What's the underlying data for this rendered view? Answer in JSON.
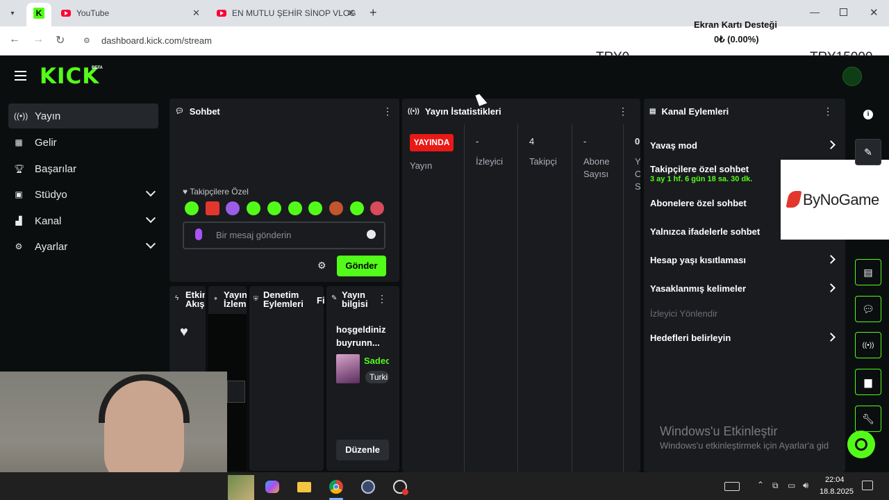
{
  "browser": {
    "tabs": [
      {
        "label": "YouTube"
      },
      {
        "label": "EN MUTLU ŞEHİR SİNOP VLOG"
      }
    ],
    "url": "dashboard.kick.com/stream"
  },
  "overlay": {
    "title": "Ekran Kartı Desteği",
    "amount": "0₺ (0.00%)",
    "min_label": "TRY0",
    "max_label": "TRY15000",
    "progress": 0,
    "sponsor": "ByNoGame"
  },
  "header": {
    "logo": "KICK",
    "beta": "BETA"
  },
  "sidebar": {
    "items": [
      {
        "label": "Yayın",
        "icon": "broadcast-icon",
        "active": true
      },
      {
        "label": "Gelir",
        "icon": "revenue-icon"
      },
      {
        "label": "Başarılar",
        "icon": "trophy-icon"
      },
      {
        "label": "Stüdyo",
        "icon": "studio-icon"
      },
      {
        "label": "Kanal",
        "icon": "channel-icon"
      },
      {
        "label": "Ayarlar",
        "icon": "gear-icon"
      }
    ]
  },
  "chat": {
    "title": "Sohbet",
    "followers_only": "Takipçilere Özel",
    "placeholder": "Bir mesaj gönderin",
    "send_label": "Gönder"
  },
  "lower_tabs": [
    {
      "label": "Etkin Akışı"
    },
    {
      "label": "Yayın İzlem"
    },
    {
      "label": "Denetim Eylemleri"
    },
    {
      "label": "Fi"
    },
    {
      "label": "Yayın bilgisi"
    }
  ],
  "stream_info": {
    "title": "hoşgeldiniz buyrunn...",
    "category": "Sadec",
    "tag": "Turki",
    "edit_label": "Düzenle"
  },
  "stats": {
    "title": "Yayın İstatistikleri",
    "live_badge": "YAYINDA",
    "columns": [
      {
        "value": "",
        "label": "Yayın"
      },
      {
        "value": "-",
        "label": "İzleyici"
      },
      {
        "value": "4",
        "label": "Takipçi"
      },
      {
        "value": "-",
        "label": "Abone Sayısı"
      },
      {
        "value": "0",
        "label": "Y O S"
      }
    ]
  },
  "channel_actions": {
    "title": "Kanal Eylemleri",
    "items": [
      {
        "label": "Yavaş mod"
      },
      {
        "label": "Takipçilere özel sohbet",
        "sub": "3 ay 1 hf. 6 gün 18 sa. 30 dk."
      },
      {
        "label": "Abonelere özel sohbet"
      },
      {
        "label": "Yalnızca ifadelerle sohbet"
      },
      {
        "label": "Hesap yaşı kısıtlaması"
      },
      {
        "label": "Yasaklanmış kelimeler"
      },
      {
        "label": "İzleyici Yönlendir"
      },
      {
        "label": "Hedefleri belirleyin"
      }
    ]
  },
  "watermark": {
    "line1": "Windows'u Etkinleştir",
    "line2": "Windows'u etkinleştirmek için Ayarlar'a gid"
  },
  "taskbar": {
    "time": "22:04",
    "date": "18.8.2025"
  },
  "colors": {
    "brand": "#53fc18",
    "live": "#e91916",
    "bg": "#0b0e0f",
    "panel": "#191b1f"
  }
}
